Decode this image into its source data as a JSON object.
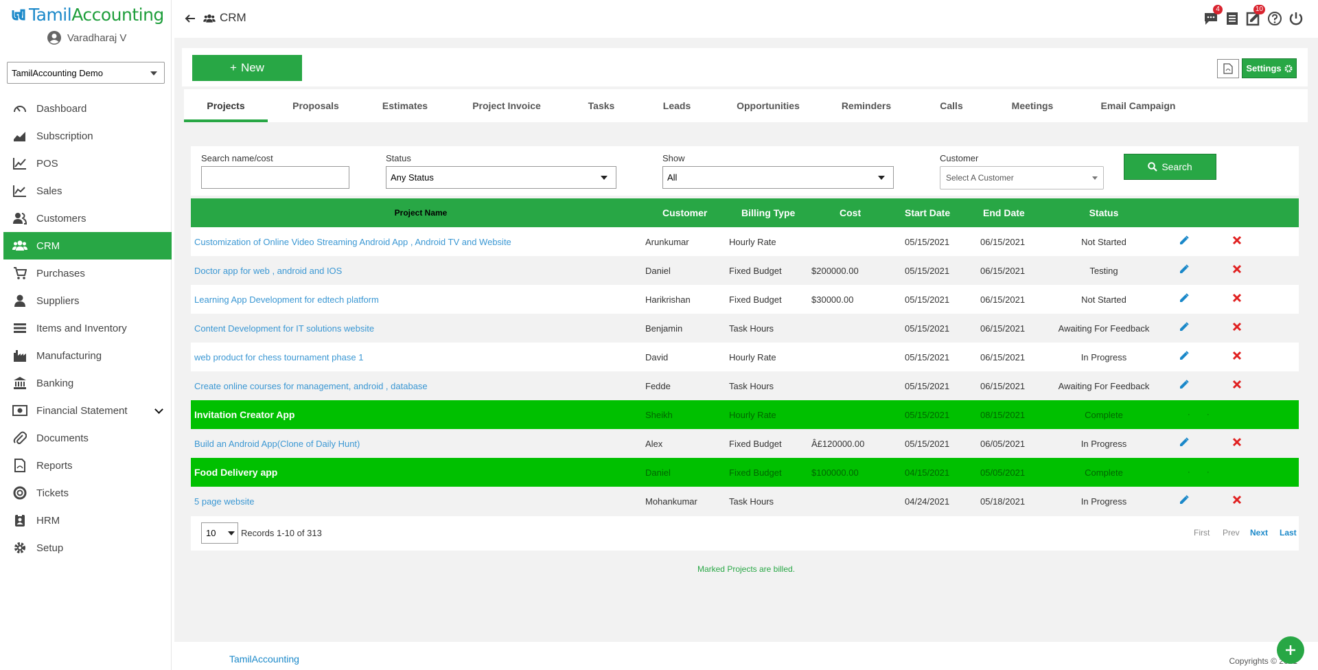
{
  "app": {
    "logo_part1": "Tamil",
    "logo_part2": "Accounting",
    "user_name": "Varadharaj V",
    "company": "TamilAccounting Demo"
  },
  "sidebar": {
    "items": [
      {
        "label": "Dashboard",
        "icon": "speedometer-icon"
      },
      {
        "label": "Subscription",
        "icon": "area-chart-icon"
      },
      {
        "label": "POS",
        "icon": "line-chart-icon"
      },
      {
        "label": "Sales",
        "icon": "trend-chart-icon"
      },
      {
        "label": "Customers",
        "icon": "users-icon"
      },
      {
        "label": "CRM",
        "icon": "group-icon",
        "active": true
      },
      {
        "label": "Purchases",
        "icon": "cart-icon"
      },
      {
        "label": "Suppliers",
        "icon": "person-icon"
      },
      {
        "label": "Items and Inventory",
        "icon": "list-icon"
      },
      {
        "label": "Manufacturing",
        "icon": "factory-icon"
      },
      {
        "label": "Banking",
        "icon": "bank-icon"
      },
      {
        "label": "Financial Statement",
        "icon": "money-icon"
      },
      {
        "label": "Documents",
        "icon": "paperclip-icon"
      },
      {
        "label": "Reports",
        "icon": "pdf-file-icon"
      },
      {
        "label": "Tickets",
        "icon": "lifebuoy-icon"
      },
      {
        "label": "HRM",
        "icon": "id-badge-icon"
      },
      {
        "label": "Setup",
        "icon": "gear-icon"
      }
    ]
  },
  "header": {
    "title": "CRM",
    "badges": {
      "chat": "4",
      "tasks": "10"
    }
  },
  "actions": {
    "new_label": "New",
    "settings_label": "Settings"
  },
  "tabs": [
    "Projects",
    "Proposals",
    "Estimates",
    "Project Invoice",
    "Tasks",
    "Leads",
    "Opportunities",
    "Reminders",
    "Calls",
    "Meetings",
    "Email Campaign"
  ],
  "filters": {
    "search_label": "Search name/cost",
    "search_value": "",
    "status_label": "Status",
    "status_value": "Any Status",
    "show_label": "Show",
    "show_value": "All",
    "customer_label": "Customer",
    "customer_placeholder": "Select A Customer",
    "search_button": "Search"
  },
  "table": {
    "headers": {
      "name": "Project Name",
      "customer": "Customer",
      "billing": "Billing Type",
      "cost": "Cost",
      "start": "Start Date",
      "end": "End Date",
      "status": "Status"
    },
    "rows": [
      {
        "name": "Customization of Online Video Streaming Android App , Android TV and Website",
        "customer": "Arunkumar",
        "billing": "Hourly Rate",
        "cost": "",
        "start": "05/15/2021",
        "end": "06/15/2021",
        "status": "Not Started",
        "billed": false
      },
      {
        "name": "Doctor app for web , android and IOS",
        "customer": "Daniel",
        "billing": "Fixed Budget",
        "cost": "$200000.00",
        "start": "05/15/2021",
        "end": "06/15/2021",
        "status": "Testing",
        "billed": false
      },
      {
        "name": "Learning App Development for edtech platform",
        "customer": "Harikrishan",
        "billing": "Fixed Budget",
        "cost": "$30000.00",
        "start": "05/15/2021",
        "end": "06/15/2021",
        "status": "Not Started",
        "billed": false
      },
      {
        "name": "Content Development for IT solutions website",
        "customer": "Benjamin",
        "billing": "Task Hours",
        "cost": "",
        "start": "05/15/2021",
        "end": "06/15/2021",
        "status": "Awaiting For Feedback",
        "billed": false
      },
      {
        "name": "web product for chess tournament phase 1",
        "customer": "David",
        "billing": "Hourly Rate",
        "cost": "",
        "start": "05/15/2021",
        "end": "06/15/2021",
        "status": "In Progress",
        "billed": false
      },
      {
        "name": "Create online courses for management, android , database",
        "customer": "Fedde",
        "billing": "Task Hours",
        "cost": "",
        "start": "05/15/2021",
        "end": "06/15/2021",
        "status": "Awaiting For Feedback",
        "billed": false
      },
      {
        "name": "Invitation Creator App",
        "customer": "Sheikh",
        "billing": "Hourly Rate",
        "cost": "",
        "start": "05/15/2021",
        "end": "08/15/2021",
        "status": "Complete",
        "billed": true
      },
      {
        "name": "Build an Android App(Clone of Daily Hunt)",
        "customer": "Alex",
        "billing": "Fixed Budget",
        "cost": "Â£120000.00",
        "start": "05/15/2021",
        "end": "06/05/2021",
        "status": "In Progress",
        "billed": false
      },
      {
        "name": "Food Delivery app",
        "customer": "Daniel",
        "billing": "Fixed Budget",
        "cost": "$100000.00",
        "start": "04/15/2021",
        "end": "05/05/2021",
        "status": "Complete",
        "billed": true
      },
      {
        "name": "5 page website",
        "customer": "Mohankumar",
        "billing": "Task Hours",
        "cost": "",
        "start": "04/24/2021",
        "end": "05/18/2021",
        "status": "In Progress",
        "billed": false
      }
    ]
  },
  "pager": {
    "page_size": "10",
    "records": "Records 1-10 of 313",
    "first": "First",
    "prev": "Prev",
    "next": "Next",
    "last": "Last"
  },
  "note": "Marked Projects are billed.",
  "footer": {
    "brand": "TamilAccounting",
    "copyright": "Copyrights © 2021"
  },
  "colors": {
    "accent": "#28a745",
    "billed_row": "#00c000",
    "link": "#3a97d3",
    "delete": "#e02020"
  }
}
